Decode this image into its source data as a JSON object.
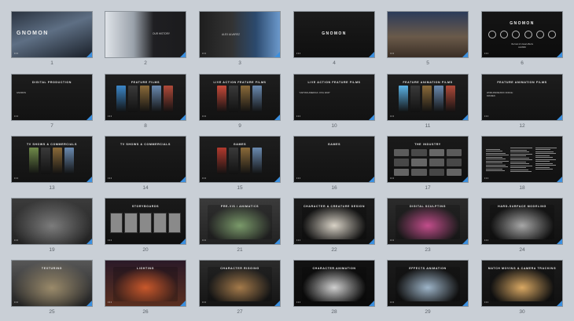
{
  "slides": [
    {
      "number": "1",
      "title": "",
      "big": "GNOMON",
      "sub": [],
      "theme": "city",
      "accent": "#7aa6d8"
    },
    {
      "number": "2",
      "title": "",
      "big": "",
      "sub": [
        "OUR HISTORY"
      ],
      "theme": "robot",
      "accent": "#d5d5d5"
    },
    {
      "number": "3",
      "title": "",
      "big": "",
      "sub": [
        "ALEX ALVAREZ"
      ],
      "theme": "portrait",
      "accent": "#6aa0d8"
    },
    {
      "number": "4",
      "title": "",
      "big": "GNOMON",
      "sub": [],
      "theme": "dark",
      "accent": "#444"
    },
    {
      "number": "5",
      "title": "",
      "big": "",
      "sub": [],
      "theme": "building",
      "accent": "#d69a3c"
    },
    {
      "number": "6",
      "title": "",
      "big": "GNOMON",
      "sub": [
        "the best of visual effects",
        "ALUMNI"
      ],
      "theme": "laurels",
      "accent": "#c8c8c8"
    },
    {
      "number": "7",
      "title": "DIGITAL PRODUCTION",
      "big": "",
      "sub": [
        "GNOMON"
      ],
      "theme": "text",
      "accent": "#999"
    },
    {
      "number": "8",
      "title": "FEATURE FILMS",
      "big": "",
      "sub": [],
      "theme": "posters",
      "accent": "#3c87c9"
    },
    {
      "number": "9",
      "title": "LIVE ACTION FEATURE FILMS",
      "big": "",
      "sub": [],
      "theme": "posters",
      "accent": "#c94a3a"
    },
    {
      "number": "10",
      "title": "LIVE ACTION FEATURE FILMS",
      "big": "",
      "sub": [
        "“CAPTAIN AMERICA: CIVIL WAR”"
      ],
      "theme": "text",
      "accent": "#e6a12b"
    },
    {
      "number": "11",
      "title": "FEATURE ANIMATION FILMS",
      "big": "",
      "sub": [],
      "theme": "posters",
      "accent": "#5bb3e6"
    },
    {
      "number": "12",
      "title": "FEATURE ANIMATION FILMS",
      "big": "",
      "sub": [
        "WORLDWIDE BOX OFFICE:",
        "FROZEN"
      ],
      "theme": "text",
      "accent": "#e6a12b"
    },
    {
      "number": "13",
      "title": "TV SHOWS & COMMERCIALS",
      "big": "",
      "sub": [],
      "theme": "posters",
      "accent": "#6f8a4a"
    },
    {
      "number": "14",
      "title": "TV SHOWS & COMMERCIALS",
      "big": "",
      "sub": [],
      "theme": "text",
      "accent": "#e6a12b"
    },
    {
      "number": "15",
      "title": "GAMES",
      "big": "",
      "sub": [],
      "theme": "posters",
      "accent": "#b23a2e"
    },
    {
      "number": "16",
      "title": "GAMES",
      "big": "",
      "sub": [],
      "theme": "text",
      "accent": "#e6a12b"
    },
    {
      "number": "17",
      "title": "THE INDUSTRY",
      "big": "",
      "sub": [],
      "theme": "logos",
      "accent": "#ffffff"
    },
    {
      "number": "18",
      "title": "",
      "big": "",
      "sub": [],
      "theme": "list",
      "accent": "#ffffff"
    },
    {
      "number": "19",
      "title": "",
      "big": "",
      "sub": [],
      "theme": "mech",
      "accent": "#7c7c7c"
    },
    {
      "number": "20",
      "title": "STORYBOARDS",
      "big": "",
      "sub": [],
      "theme": "film",
      "accent": "#999"
    },
    {
      "number": "21",
      "title": "PRE-VIS / ANIMATICS",
      "big": "",
      "sub": [],
      "theme": "previs",
      "accent": "#7a9a6a"
    },
    {
      "number": "22",
      "title": "CHARACTER & CREATURE DESIGN",
      "big": "",
      "sub": [],
      "theme": "sketch",
      "accent": "#d8d2c6"
    },
    {
      "number": "23",
      "title": "DIGITAL SCULPTING",
      "big": "",
      "sub": [],
      "theme": "sculpt",
      "accent": "#c24d8b"
    },
    {
      "number": "24",
      "title": "HARD-SURFACE MODELING",
      "big": "",
      "sub": [],
      "theme": "hardsurf",
      "accent": "#a7a7a7"
    },
    {
      "number": "25",
      "title": "TEXTURING",
      "big": "",
      "sub": [],
      "theme": "vehicle",
      "accent": "#9a8a6a"
    },
    {
      "number": "26",
      "title": "LIGHTING",
      "big": "",
      "sub": [],
      "theme": "lighting",
      "accent": "#c9582b"
    },
    {
      "number": "27",
      "title": "CHARACTER RIGGING",
      "big": "",
      "sub": [],
      "theme": "rig",
      "accent": "#a47a4a"
    },
    {
      "number": "28",
      "title": "CHARACTER ANIMATION",
      "big": "",
      "sub": [],
      "theme": "anim",
      "accent": "#cfcfcf"
    },
    {
      "number": "29",
      "title": "EFFECTS ANIMATION",
      "big": "",
      "sub": [],
      "theme": "fx",
      "accent": "#9db4c8"
    },
    {
      "number": "30",
      "title": "MATCH MOVING & CAMERA TRACKING",
      "big": "",
      "sub": [],
      "theme": "desert",
      "accent": "#d9a863"
    }
  ],
  "corner_color": "#3b8fdf",
  "dots_glyph": "•••"
}
